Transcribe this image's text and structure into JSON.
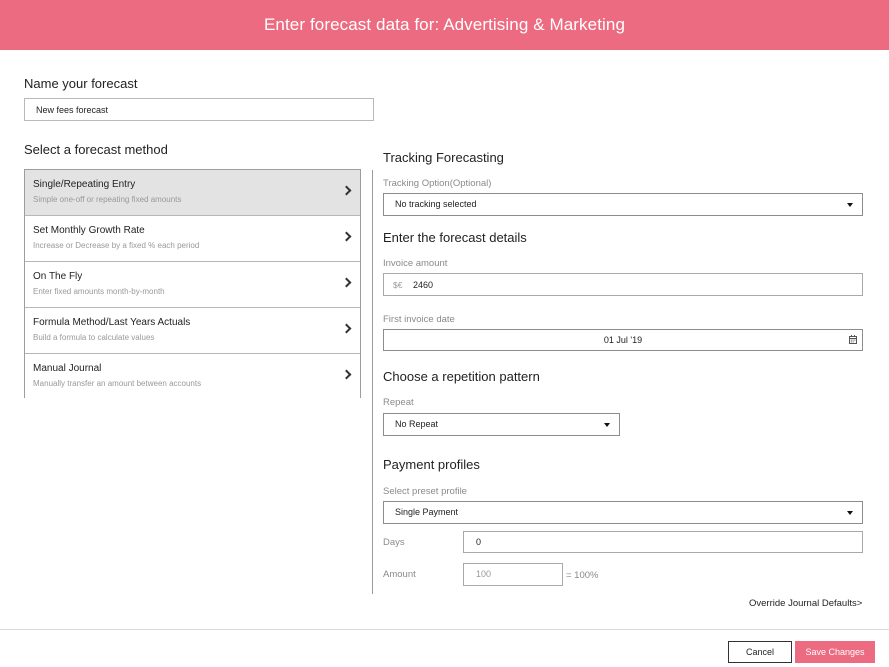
{
  "header": {
    "title": "Enter forecast data for: Advertising & Marketing"
  },
  "name_section": {
    "label": "Name your forecast",
    "value": "New fees forecast"
  },
  "method_section": {
    "label": "Select a forecast method",
    "items": [
      {
        "title": "Single/Repeating Entry",
        "desc": "Simple one-off or repeating fixed amounts",
        "selected": true
      },
      {
        "title": "Set Monthly Growth Rate",
        "desc": "Increase or Decrease by a fixed % each period",
        "selected": false
      },
      {
        "title": "On The Fly",
        "desc": "Enter fixed amounts month-by-month",
        "selected": false
      },
      {
        "title": "Formula Method/Last Years Actuals",
        "desc": "Build a formula to calculate values",
        "selected": false
      },
      {
        "title": "Manual Journal",
        "desc": "Manually transfer an amount between accounts",
        "selected": false
      }
    ]
  },
  "tracking": {
    "title": "Tracking Forecasting",
    "option_label": "Tracking Option(Optional)",
    "option_value": "No tracking selected"
  },
  "details": {
    "title": "Enter the forecast details",
    "invoice_label": "Invoice amount",
    "currency": "$€",
    "invoice_value": "2460",
    "date_label": "First invoice date",
    "date_value": "01 Jul '19"
  },
  "repetition": {
    "title": "Choose a repetition pattern",
    "repeat_label": "Repeat",
    "repeat_value": "No Repeat"
  },
  "payment": {
    "title": "Payment profiles",
    "preset_label": "Select preset profile",
    "preset_value": "Single Payment",
    "days_label": "Days",
    "days_value": "0",
    "amount_label": "Amount",
    "amount_placeholder": "100",
    "amount_suffix": "= 100%"
  },
  "override_link": "Override Journal Defaults>",
  "footer": {
    "cancel": "Cancel",
    "save": "Save Changes"
  },
  "colors": {
    "accent": "#ec6b80",
    "selected_bg": "#e3e3e3"
  }
}
